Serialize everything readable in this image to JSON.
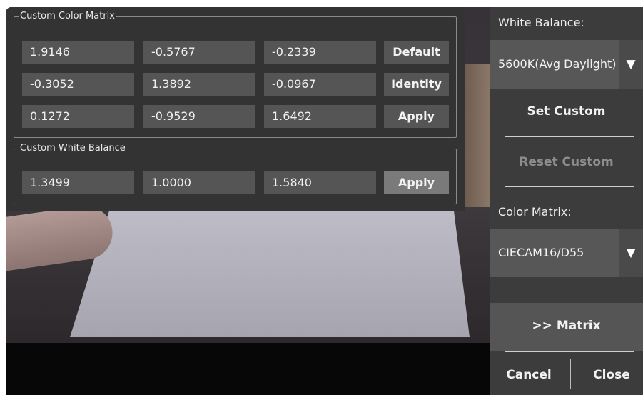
{
  "color_matrix": {
    "title": "Custom Color Matrix",
    "rows": [
      [
        "1.9146",
        "-0.5767",
        "-0.2339"
      ],
      [
        "-0.3052",
        "1.3892",
        "-0.0967"
      ],
      [
        "0.1272",
        "-0.9529",
        "1.6492"
      ]
    ],
    "buttons": {
      "default": "Default",
      "identity": "Identity",
      "apply": "Apply"
    }
  },
  "white_balance_custom": {
    "title": "Custom White Balance",
    "values": [
      "1.3499",
      "1.0000",
      "1.5840"
    ],
    "apply": "Apply"
  },
  "sidebar": {
    "white_balance_label": "White Balance:",
    "white_balance_value": "5600K(Avg Daylight)",
    "set_custom": "Set Custom",
    "reset_custom": "Reset Custom",
    "color_matrix_label": "Color Matrix:",
    "color_matrix_value": "CIECAM16/D55",
    "matrix_toggle": ">> Matrix",
    "cancel": "Cancel",
    "close": "Close",
    "dropdown_arrow": "▼"
  },
  "colors": {
    "panel_bg": "#333333",
    "field_bg": "#555555",
    "sidebar_bg": "#3c3c3c",
    "apply_highlight": "#7a7a7a"
  }
}
